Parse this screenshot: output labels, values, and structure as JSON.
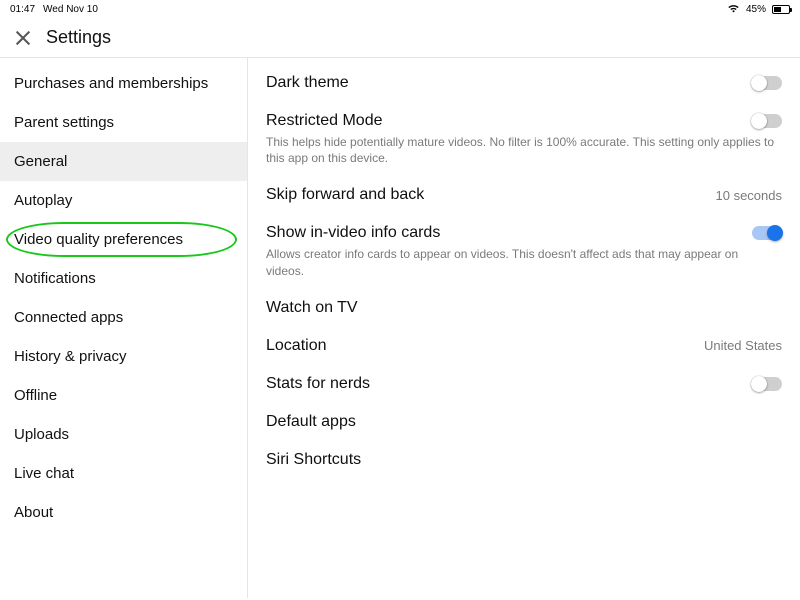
{
  "status": {
    "time": "01:47",
    "date": "Wed Nov 10",
    "battery": "45%"
  },
  "header": {
    "title": "Settings"
  },
  "sidebar": {
    "items": [
      {
        "label": "Purchases and memberships",
        "selected": false,
        "highlighted": false
      },
      {
        "label": "Parent settings",
        "selected": false,
        "highlighted": false
      },
      {
        "label": "General",
        "selected": true,
        "highlighted": false
      },
      {
        "label": "Autoplay",
        "selected": false,
        "highlighted": false
      },
      {
        "label": "Video quality preferences",
        "selected": false,
        "highlighted": true
      },
      {
        "label": "Notifications",
        "selected": false,
        "highlighted": false
      },
      {
        "label": "Connected apps",
        "selected": false,
        "highlighted": false
      },
      {
        "label": "History & privacy",
        "selected": false,
        "highlighted": false
      },
      {
        "label": "Offline",
        "selected": false,
        "highlighted": false
      },
      {
        "label": "Uploads",
        "selected": false,
        "highlighted": false
      },
      {
        "label": "Live chat",
        "selected": false,
        "highlighted": false
      },
      {
        "label": "About",
        "selected": false,
        "highlighted": false
      }
    ]
  },
  "settings": [
    {
      "key": "dark_theme",
      "title": "Dark theme",
      "type": "toggle",
      "value": false
    },
    {
      "key": "restricted_mode",
      "title": "Restricted Mode",
      "type": "toggle",
      "value": false,
      "desc": "This helps hide potentially mature videos. No filter is 100% accurate. This setting only applies to this app on this device."
    },
    {
      "key": "skip",
      "title": "Skip forward and back",
      "type": "value",
      "value": "10 seconds"
    },
    {
      "key": "info_cards",
      "title": "Show in-video info cards",
      "type": "toggle",
      "value": true,
      "desc": "Allows creator info cards to appear on videos. This doesn't affect ads that may appear on videos."
    },
    {
      "key": "watch_tv",
      "title": "Watch on TV",
      "type": "link"
    },
    {
      "key": "location",
      "title": "Location",
      "type": "value",
      "value": "United States"
    },
    {
      "key": "stats",
      "title": "Stats for nerds",
      "type": "toggle",
      "value": false
    },
    {
      "key": "default_apps",
      "title": "Default apps",
      "type": "link"
    },
    {
      "key": "siri",
      "title": "Siri Shortcuts",
      "type": "link"
    }
  ]
}
